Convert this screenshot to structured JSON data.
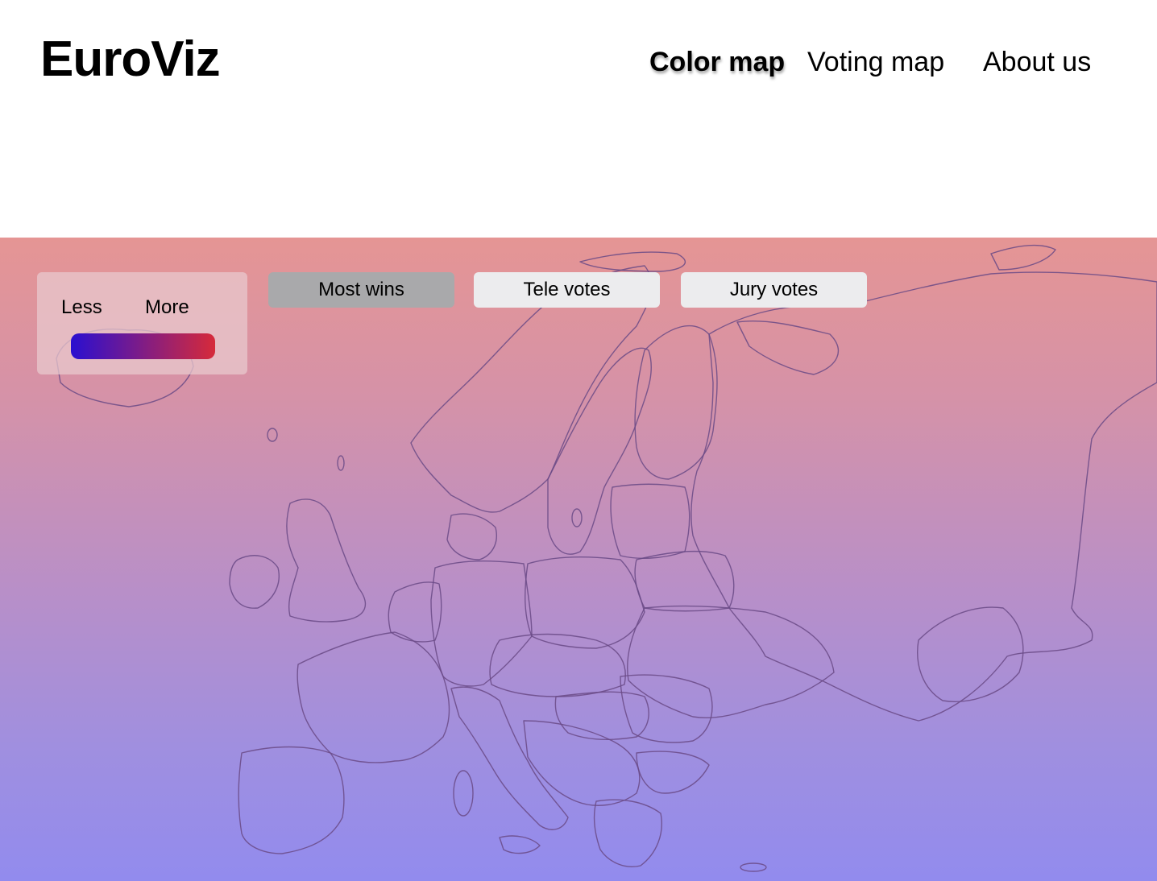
{
  "header": {
    "logo": "EuroViz",
    "nav": [
      {
        "label": "Color map",
        "active": true
      },
      {
        "label": "Voting map",
        "active": false
      },
      {
        "label": "About us",
        "active": false
      }
    ]
  },
  "legend": {
    "less_label": "Less",
    "more_label": "More",
    "gradient_start": "#2a0fd0",
    "gradient_end": "#d62a3a"
  },
  "filters": [
    {
      "label": "Most wins",
      "selected": true
    },
    {
      "label": "Tele votes",
      "selected": false
    },
    {
      "label": "Jury votes",
      "selected": false
    }
  ],
  "map": {
    "region": "Europe",
    "gradient_top": "#e59594",
    "gradient_bottom": "#928bee",
    "border_color": "#6a4a86"
  }
}
